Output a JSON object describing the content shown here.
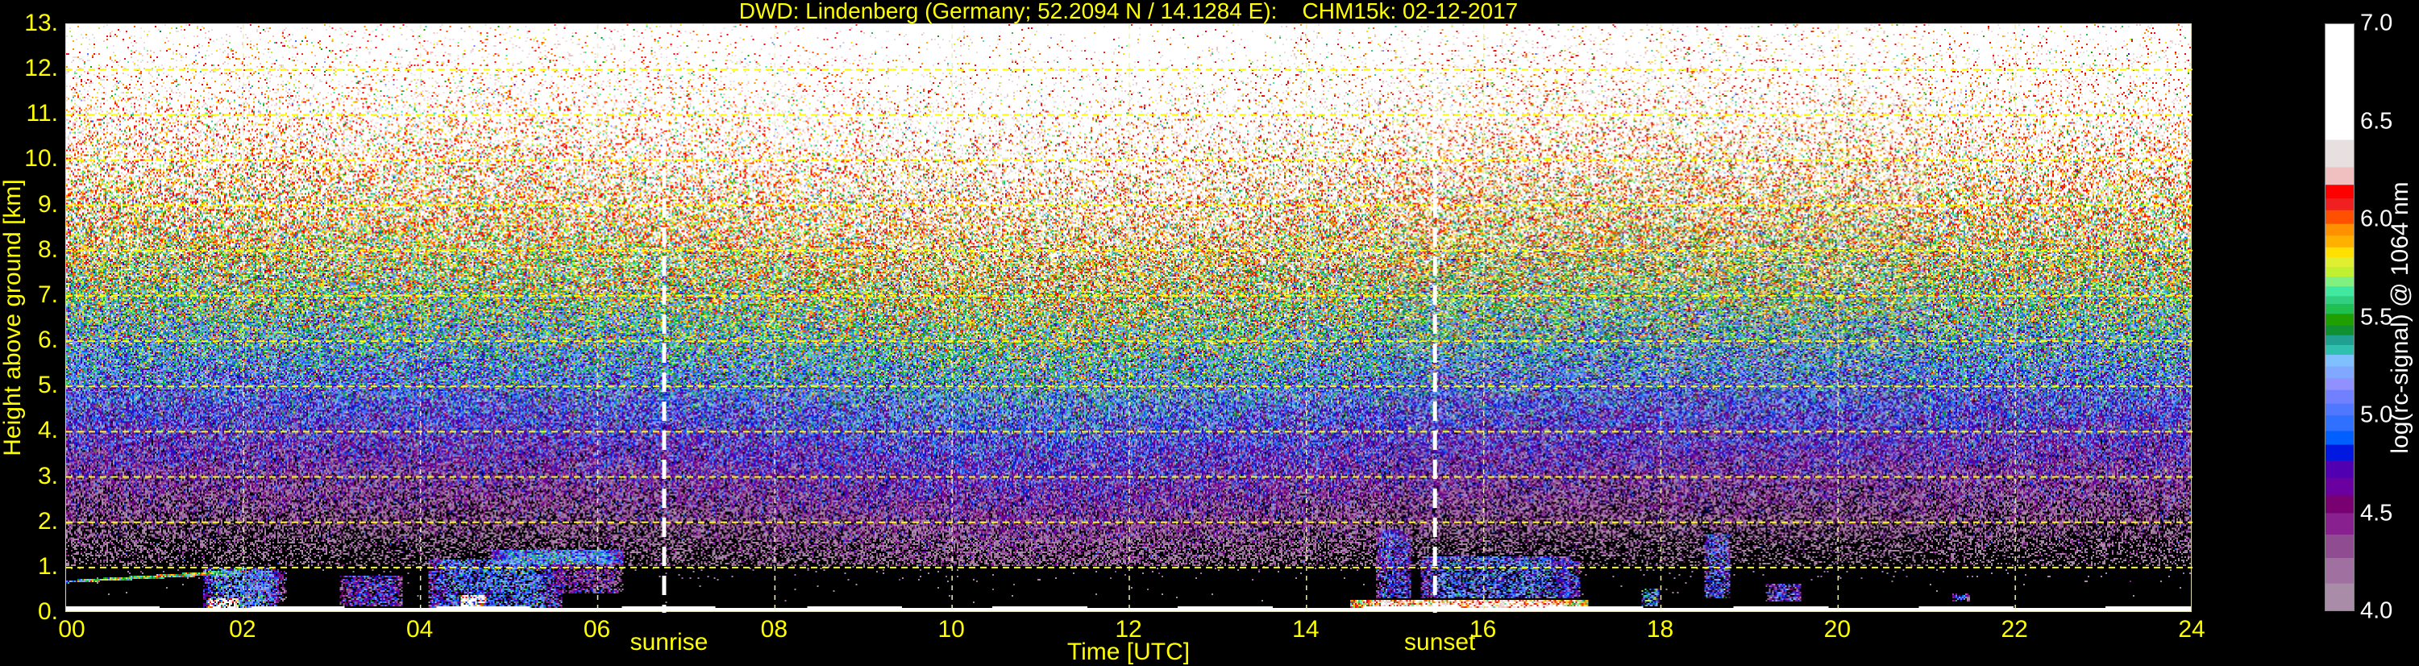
{
  "chart_data": {
    "type": "heatmap",
    "title": "DWD: Lindenberg (Germany; 52.2094 N / 14.1284 E):    CHM15k: 02-12-2017",
    "xlabel": "Time [UTC]",
    "ylabel": "Height above ground [km]",
    "xlim": [
      0,
      24
    ],
    "ylim": [
      0,
      13
    ],
    "xticks": [
      0,
      2,
      4,
      6,
      8,
      10,
      12,
      14,
      16,
      18,
      20,
      22,
      24
    ],
    "xtick_labels": [
      "00",
      "02",
      "04",
      "06",
      "08",
      "10",
      "12",
      "14",
      "16",
      "18",
      "20",
      "22",
      "24"
    ],
    "yticks": [
      0,
      1,
      2,
      3,
      4,
      5,
      6,
      7,
      8,
      9,
      10,
      11,
      12,
      13
    ],
    "ytick_labels": [
      "0.",
      "1.",
      "2.",
      "3.",
      "4.",
      "5.",
      "6.",
      "7.",
      "8.",
      "9.",
      "10.",
      "11.",
      "12.",
      "13."
    ],
    "grid": true,
    "grid_color": "#ffff00",
    "markers": [
      {
        "label": "sunrise",
        "time": 6.75
      },
      {
        "label": "sunset",
        "time": 15.45
      }
    ],
    "colorbar": {
      "label": "log(rc-signal) @ 1064 nm",
      "range": [
        4.0,
        7.0
      ],
      "ticks": [
        4.0,
        4.5,
        5.0,
        5.5,
        6.0,
        6.5,
        7.0
      ],
      "tick_labels": [
        "4.0",
        "4.5",
        "5.0",
        "5.5",
        "6.0",
        "6.5",
        "7.0"
      ],
      "boundaries": [
        4.0,
        4.14,
        4.27,
        4.39,
        4.5,
        4.59,
        4.68,
        4.77,
        4.85,
        4.92,
        5.0,
        5.06,
        5.13,
        5.19,
        5.25,
        5.31,
        5.36,
        5.41,
        5.46,
        5.52,
        5.57,
        5.61,
        5.66,
        5.71,
        5.76,
        5.81,
        5.86,
        5.92,
        5.98,
        6.05,
        6.11,
        6.18,
        6.27,
        6.41,
        7.0
      ],
      "colors": [
        "#a88ca8",
        "#a070a0",
        "#904c90",
        "#882090",
        "#780070",
        "#6a00a0",
        "#5000b0",
        "#0018e0",
        "#0060ff",
        "#3070ff",
        "#5078ff",
        "#7080ff",
        "#9090ff",
        "#80a8ff",
        "#80c0ff",
        "#30c0b0",
        "#20a090",
        "#109030",
        "#20a000",
        "#20c050",
        "#30d080",
        "#40e8a0",
        "#80f080",
        "#c0f030",
        "#e0f030",
        "#ffe000",
        "#ffb000",
        "#ff9000",
        "#ff5000",
        "#f02020",
        "#ff0000",
        "#f0c0c0",
        "#e8e0e0",
        "#ffffff"
      ]
    },
    "features": [
      {
        "kind": "residual-layer",
        "time": [
          0.0,
          2.0
        ],
        "height": [
          0.65,
          0.85
        ],
        "value": 5.6
      },
      {
        "kind": "aerosol",
        "time": [
          1.55,
          2.4
        ],
        "height": [
          0.0,
          0.95
        ],
        "value": 5.1
      },
      {
        "kind": "aerosol",
        "time": [
          1.6,
          1.95
        ],
        "height": [
          0.0,
          0.3
        ],
        "value": 6.6
      },
      {
        "kind": "aerosol",
        "time": [
          2.0,
          2.5
        ],
        "height": [
          0.2,
          0.9
        ],
        "value": 4.5
      },
      {
        "kind": "aerosol",
        "time": [
          3.1,
          3.8
        ],
        "height": [
          0.1,
          0.8
        ],
        "value": 4.7
      },
      {
        "kind": "aerosol",
        "time": [
          4.1,
          5.6
        ],
        "height": [
          0.0,
          1.15
        ],
        "value": 5.0
      },
      {
        "kind": "aerosol",
        "time": [
          4.45,
          4.75
        ],
        "height": [
          0.0,
          0.35
        ],
        "value": 6.6
      },
      {
        "kind": "elevated-layer",
        "time": [
          4.8,
          6.3
        ],
        "height": [
          1.05,
          1.35
        ],
        "value": 5.1
      },
      {
        "kind": "aerosol",
        "time": [
          5.5,
          6.3
        ],
        "height": [
          0.4,
          1.2
        ],
        "value": 4.4
      },
      {
        "kind": "aerosol",
        "time": [
          14.8,
          15.2
        ],
        "height": [
          0.3,
          1.8
        ],
        "value": 4.8
      },
      {
        "kind": "aerosol",
        "time": [
          15.3,
          17.0
        ],
        "height": [
          0.3,
          1.2
        ],
        "value": 5.0
      },
      {
        "kind": "aerosol",
        "time": [
          16.9,
          17.1
        ],
        "height": [
          0.3,
          1.1
        ],
        "value": 4.8
      },
      {
        "kind": "aerosol",
        "time": [
          17.8,
          18.0
        ],
        "height": [
          0.1,
          0.5
        ],
        "value": 5.3
      },
      {
        "kind": "aerosol",
        "time": [
          18.5,
          18.8
        ],
        "height": [
          0.3,
          1.7
        ],
        "value": 4.9
      },
      {
        "kind": "aerosol",
        "time": [
          19.2,
          19.6
        ],
        "height": [
          0.2,
          0.6
        ],
        "value": 4.7
      },
      {
        "kind": "aerosol",
        "time": [
          21.3,
          21.5
        ],
        "height": [
          0.2,
          0.4
        ],
        "value": 4.8
      },
      {
        "kind": "surface",
        "time": [
          14.5,
          17.2
        ],
        "height": [
          0.0,
          0.25
        ],
        "value": 6.3
      }
    ]
  }
}
